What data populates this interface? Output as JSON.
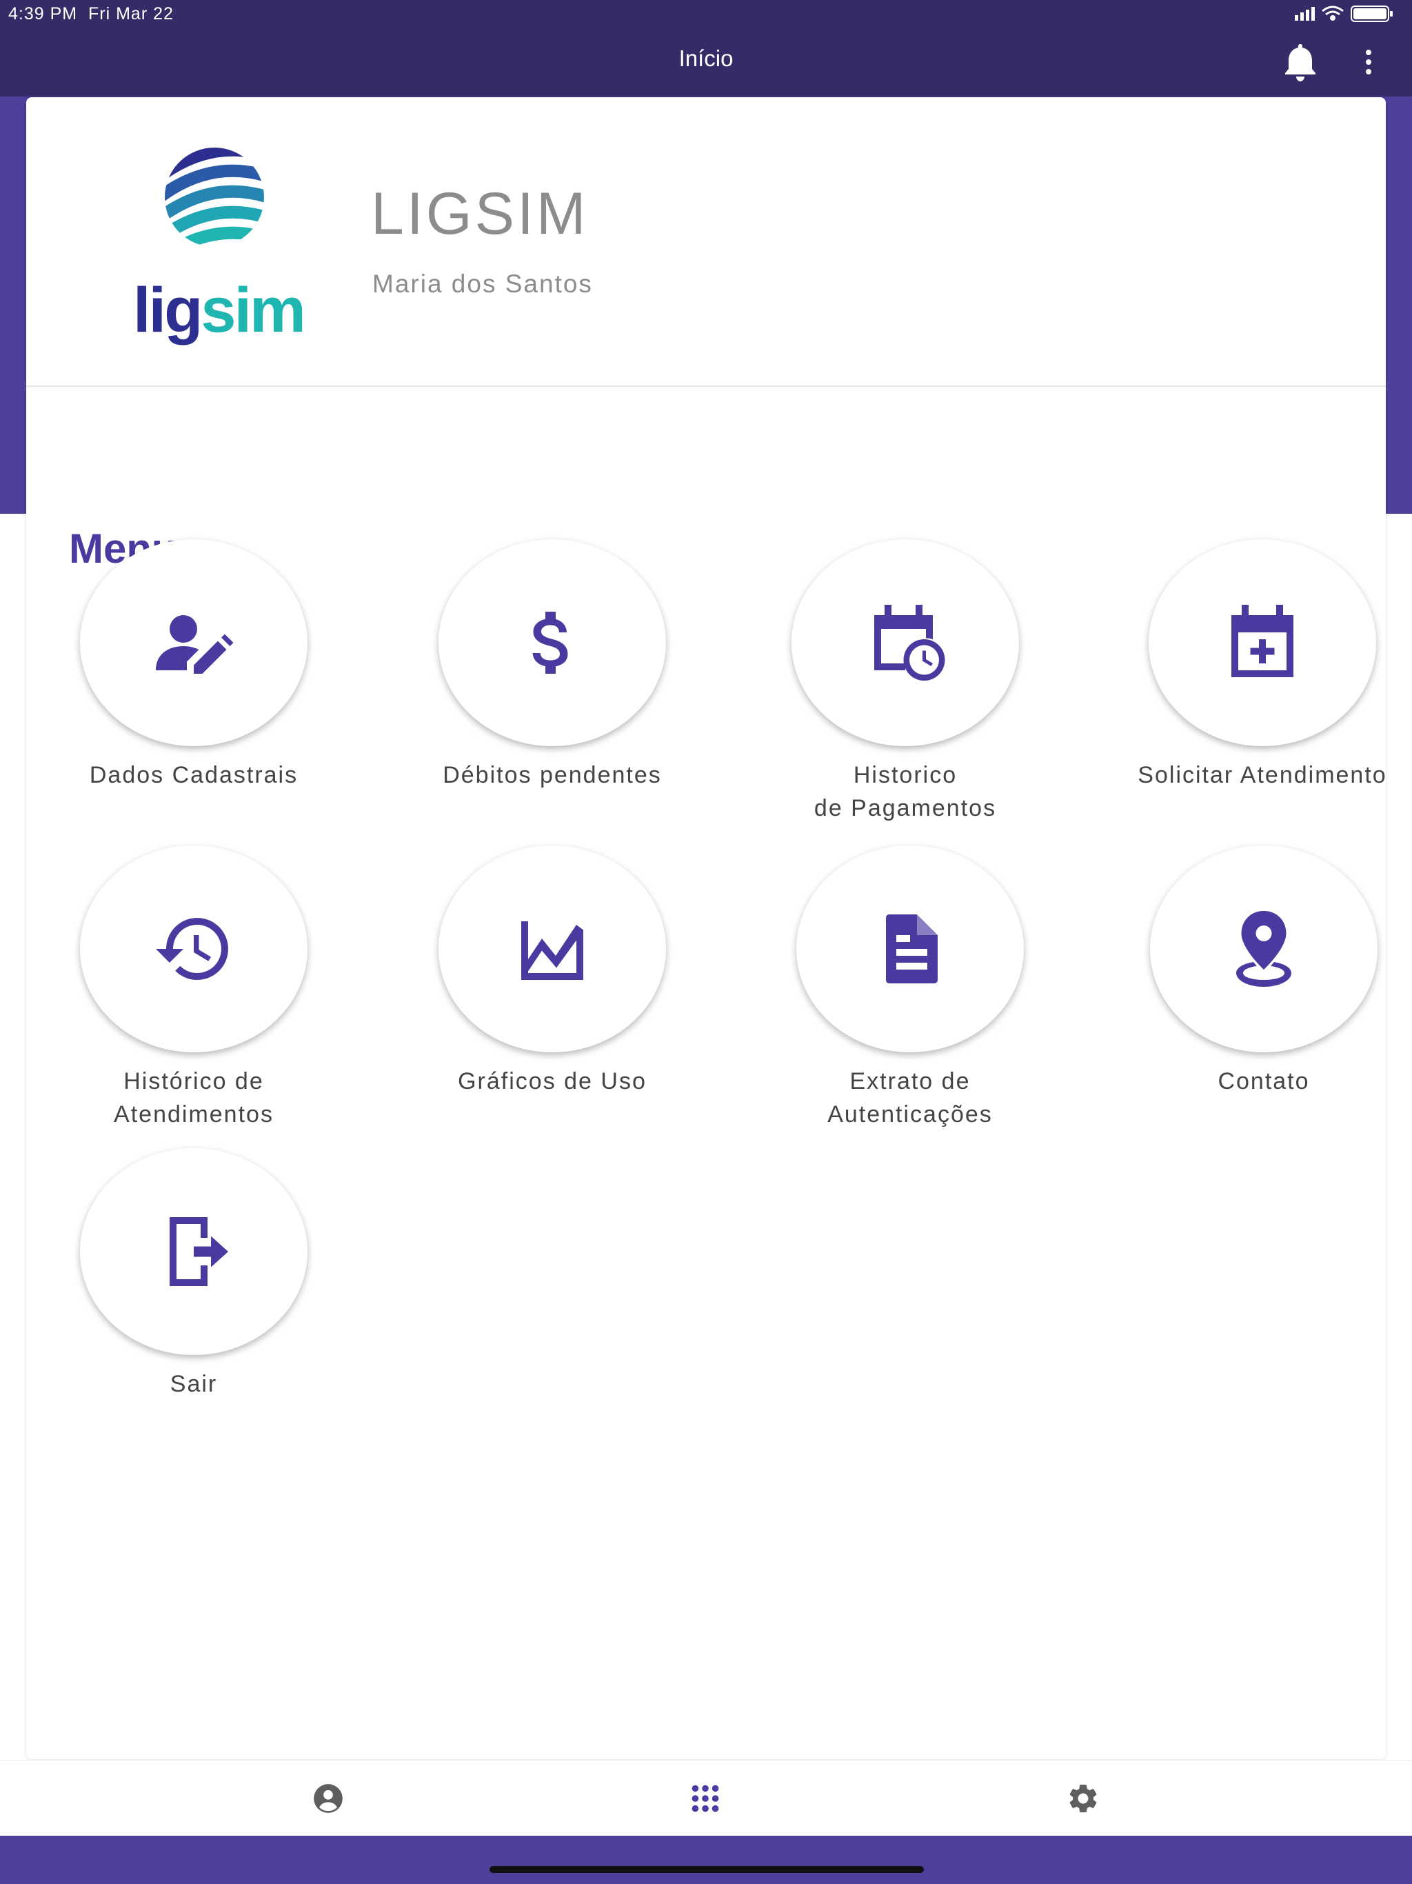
{
  "status_bar": {
    "time": "4:39 PM",
    "date": "Fri Mar 22"
  },
  "app_bar": {
    "title": "Início"
  },
  "profile": {
    "company": "LIGSIM",
    "user_name": "Maria dos Santos",
    "logo_text_a": "lig",
    "logo_text_b": "sim"
  },
  "menu": {
    "heading": "Menu",
    "items": [
      {
        "label": "Dados Cadastrais",
        "icon": "user-edit-icon"
      },
      {
        "label": "Débitos pendentes",
        "icon": "dollar-icon"
      },
      {
        "label": "Historico\nde Pagamentos",
        "icon": "calendar-clock-icon"
      },
      {
        "label": "Solicitar Atendimento",
        "icon": "calendar-add-icon"
      },
      {
        "label": "Histórico de\nAtendimentos",
        "icon": "history-icon"
      },
      {
        "label": "Gráficos de Uso",
        "icon": "chart-icon"
      },
      {
        "label": "Extrato de\nAutenticações",
        "icon": "document-icon"
      },
      {
        "label": "Contato",
        "icon": "location-pin-icon"
      },
      {
        "label": "Sair",
        "icon": "logout-icon"
      }
    ]
  },
  "bottom_nav": [
    {
      "name": "profile",
      "icon": "account-circle-icon"
    },
    {
      "name": "apps",
      "icon": "apps-grid-icon"
    },
    {
      "name": "settings",
      "icon": "gear-icon"
    }
  ],
  "colors": {
    "primary": "#352b66",
    "accent": "#4a3aa0",
    "band": "#4f3f9a",
    "logo_navy": "#2c2f8f",
    "logo_teal": "#1fb5b0"
  }
}
